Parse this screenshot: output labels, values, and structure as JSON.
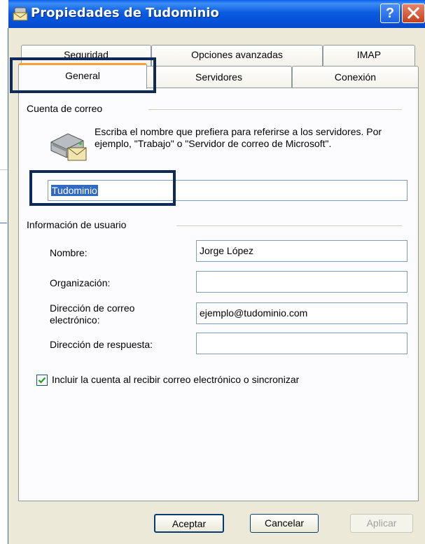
{
  "window": {
    "title": "Propiedades de Tudominio"
  },
  "titlebar": {
    "help_label": "?",
    "close_icon": "close-icon"
  },
  "tabs": {
    "row1": [
      "Seguridad",
      "Opciones avanzadas",
      "IMAP"
    ],
    "row2": [
      "General",
      "Servidores",
      "Conexión"
    ],
    "active": "General"
  },
  "mail_account": {
    "group_label": "Cuenta de correo",
    "description": "Escriba el nombre que prefiera para referirse a los servidores. Por ejemplo, \"Trabajo\" o \"Servidor de correo de Microsoft\".",
    "account_name_value": "Tudominio",
    "icon": "mail-server-icon"
  },
  "user_info": {
    "group_label": "Información de usuario",
    "name_label": "Nombre:",
    "name_value": "Jorge López",
    "org_label": "Organización:",
    "org_value": "",
    "email_label_line1": "Dirección de correo",
    "email_label_line2": "electrónico:",
    "email_value": "ejemplo@tudominio.com",
    "reply_label": "Dirección de respuesta:",
    "reply_value": ""
  },
  "include_account": {
    "label": "Incluir la cuenta al recibir correo electrónico o sincronizar",
    "checked": true
  },
  "buttons": {
    "ok": "Aceptar",
    "cancel": "Cancelar",
    "apply": "Aplicar"
  },
  "colors": {
    "titlebar": "#0a5ce0",
    "dialog_bg": "#ece9d8",
    "highlight_box": "#102a58",
    "selection": "#316ac5"
  }
}
